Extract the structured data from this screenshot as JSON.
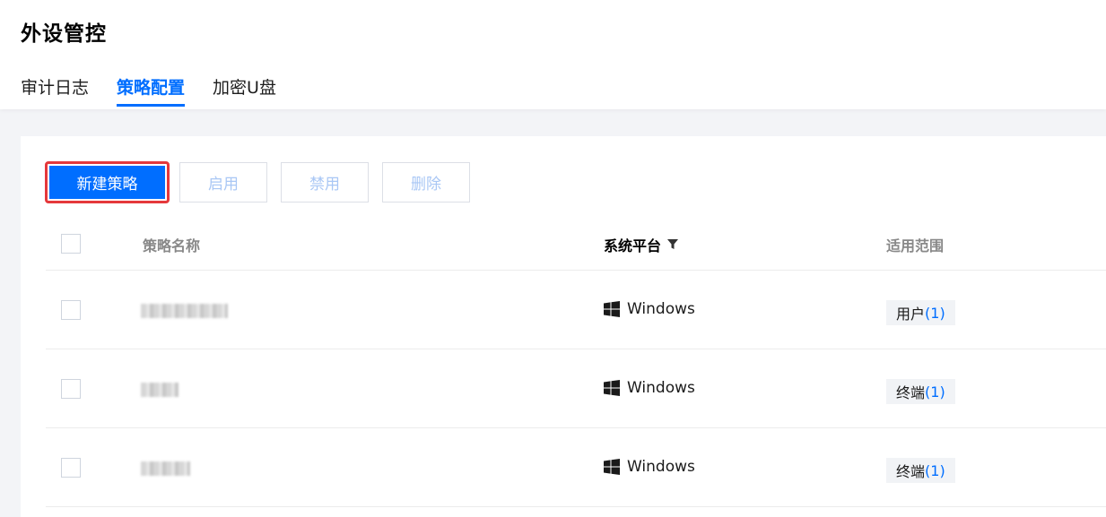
{
  "page": {
    "title": "外设管控"
  },
  "tabs": [
    {
      "label": "审计日志",
      "active": false
    },
    {
      "label": "策略配置",
      "active": true
    },
    {
      "label": "加密U盘",
      "active": false
    }
  ],
  "toolbar": {
    "new_label": "新建策略",
    "enable_label": "启用",
    "disable_label": "禁用",
    "delete_label": "删除"
  },
  "table": {
    "headers": {
      "name": "策略名称",
      "platform": "系统平台",
      "scope": "适用范围"
    },
    "rows": [
      {
        "name": "",
        "platform": "Windows",
        "scope_label": "用户",
        "scope_count": "(1)"
      },
      {
        "name": "",
        "platform": "Windows",
        "scope_label": "终端",
        "scope_count": "(1)"
      },
      {
        "name": "",
        "platform": "Windows",
        "scope_label": "终端",
        "scope_count": "(1)"
      }
    ]
  },
  "colors": {
    "accent": "#006eff",
    "highlight_border": "#e5383b",
    "disabled_text": "#a9c7f5"
  },
  "icons": {
    "filter": "filter-icon",
    "platform": "windows-icon"
  }
}
